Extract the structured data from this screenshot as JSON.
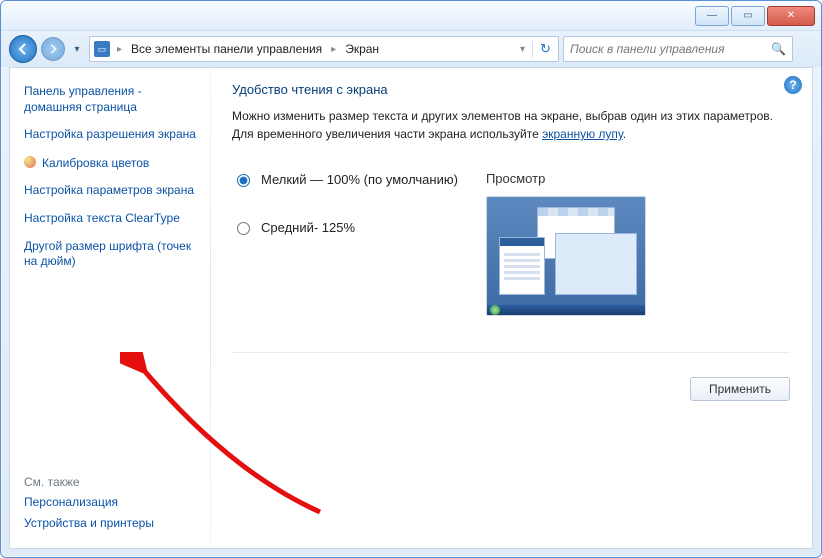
{
  "window": {
    "minimize": "—",
    "maximize": "▭",
    "close": "✕"
  },
  "breadcrumb": {
    "root_icon": "🖥",
    "seg1": "Все элементы панели управления",
    "seg2": "Экран"
  },
  "search": {
    "placeholder": "Поиск в панели управления",
    "icon": "🔍"
  },
  "sidebar": {
    "items": [
      "Панель управления - домашняя страница",
      "Настройка разрешения экрана",
      "Калибровка цветов",
      "Настройка параметров экрана",
      "Настройка текста ClearType",
      "Другой размер шрифта (точек на дюйм)"
    ],
    "see_also_header": "См. также",
    "see_also": [
      "Персонализация",
      "Устройства и принтеры"
    ]
  },
  "main": {
    "title": "Удобство чтения с экрана",
    "description_pre": "Можно изменить размер текста и других элементов на экране, выбрав один из этих параметров. Для временного увеличения части экрана используйте ",
    "description_link": "экранную лупу",
    "description_post": ".",
    "radio1": "Мелкий — 100% (по умолчанию)",
    "radio2": "Средний- 125%",
    "preview_label": "Просмотр",
    "apply": "Применить",
    "help": "?"
  }
}
